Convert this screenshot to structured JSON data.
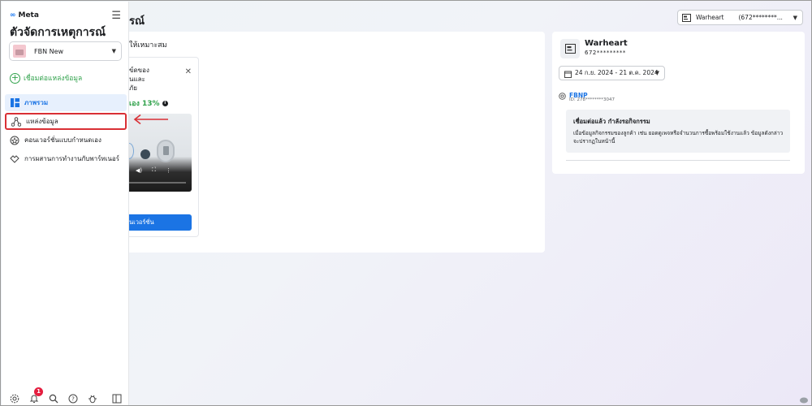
{
  "header": {
    "title_tail": "รณ์",
    "dataset_select": {
      "name": "Warheart",
      "id": "(672********...",
      "icon": "dataset-icon"
    }
  },
  "sidebar": {
    "brand": "Meta",
    "app_title": "ตัวจัดการเหตุการณ์",
    "account": {
      "name": "FBN New"
    },
    "connect_label": "เชื่อมต่อแหล่งข้อมูล",
    "items": [
      {
        "label": "ภาพรวม",
        "icon": "overview-icon",
        "active": true
      },
      {
        "label": "แหล่งข้อมูล",
        "icon": "data-sources-icon",
        "highlighted": true
      },
      {
        "label": "คอนเวอร์ชั่นแบบกำหนดเอง",
        "icon": "custom-conversion-icon"
      },
      {
        "label": "การผสานการทำงานกับพาร์ทเนอร์",
        "icon": "partner-integration-icon"
      }
    ],
    "bottom_icons": [
      "settings-icon",
      "notifications-icon",
      "search-icon",
      "help-icon",
      "bug-icon"
    ],
    "notification_count": "1"
  },
  "left_card": {
    "header_text": "ให้เหมาะสม",
    "promo": {
      "lines": [
        "ข์ดของ",
        "นและ",
        "ภัย"
      ],
      "stat": "เอง 13%",
      "button_label": "นเวอร์ชั่น"
    }
  },
  "right_card": {
    "name": "Warheart",
    "id": "672*********",
    "date_range": "24 ก.ย. 2024 - 21 ต.ค. 2024",
    "fbnp_label": "FBNP",
    "fbnp_id": "ID: 278********3047",
    "status_title": "เชื่อมต่อแล้ว กำลังรอกิจกรรม",
    "status_desc": "เมื่อข้อมูลกิจกรรมของลูกค้า เช่น ยอดดูเพจหรือจำนวนการซื้อพร้อมใช้งานแล้ว ข้อมูลดังกล่าวจะปรากฏในหน้านี้"
  },
  "colors": {
    "accent": "#1b74e4",
    "green": "#31a24c",
    "highlight": "#d93035",
    "badge": "#e41e3f"
  }
}
